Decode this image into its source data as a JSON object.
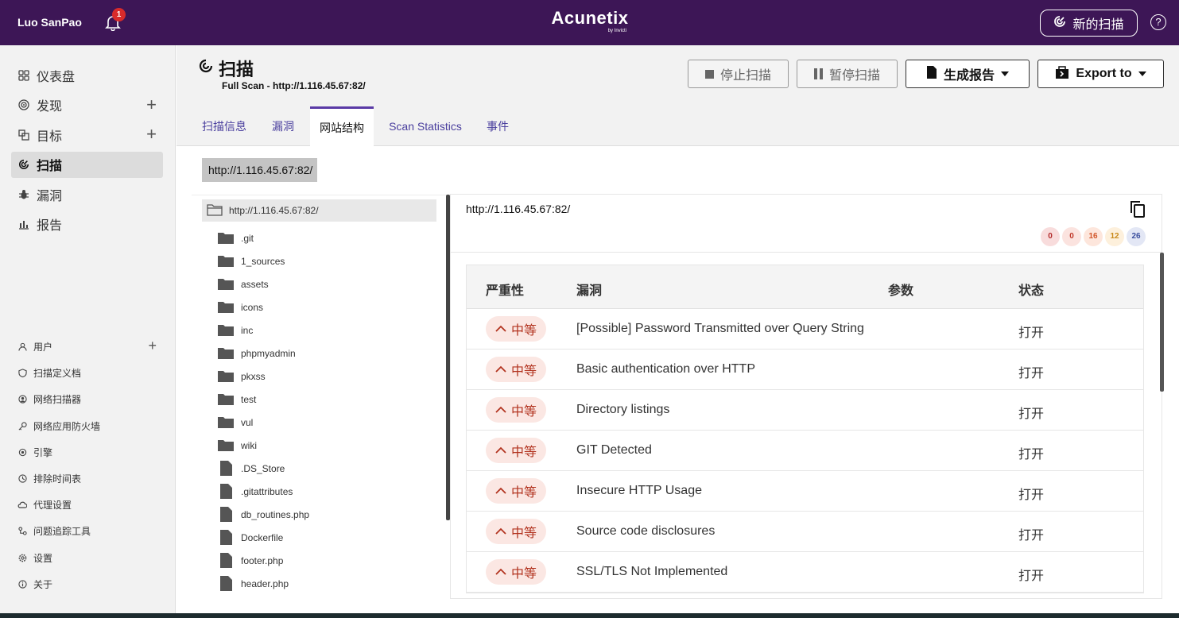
{
  "topbar": {
    "user": "Luo SanPao",
    "notification_count": "1",
    "brand": "Acunetix",
    "brand_sub": "by Invicti",
    "new_scan_label": "新的扫描",
    "help_label": "?"
  },
  "sidebar": {
    "main": [
      {
        "label": "仪表盘",
        "icon": "dashboard-icon"
      },
      {
        "label": "发现",
        "icon": "discovery-icon"
      },
      {
        "label": "目标",
        "icon": "targets-icon"
      },
      {
        "label": "扫描",
        "icon": "scan-icon"
      },
      {
        "label": "漏洞",
        "icon": "bug-icon"
      },
      {
        "label": "报告",
        "icon": "report-icon"
      }
    ],
    "sub": [
      {
        "label": "用户",
        "icon": "user-icon"
      },
      {
        "label": "扫描定义档",
        "icon": "shield-icon"
      },
      {
        "label": "网络扫描器",
        "icon": "network-icon"
      },
      {
        "label": "网络应用防火墙",
        "icon": "key-icon"
      },
      {
        "label": "引擎",
        "icon": "engine-icon"
      },
      {
        "label": "排除时间表",
        "icon": "clock-icon"
      },
      {
        "label": "代理设置",
        "icon": "cloud-icon"
      },
      {
        "label": "问题追踪工具",
        "icon": "tracker-icon"
      },
      {
        "label": "设置",
        "icon": "gear-icon"
      },
      {
        "label": "关于",
        "icon": "info-icon"
      }
    ]
  },
  "header": {
    "title": "扫描",
    "subtitle": "Full Scan - http://1.116.45.67:82/",
    "stop_label": "停止扫描",
    "pause_label": "暂停扫描",
    "report_label": "生成报告",
    "export_label": "Export to"
  },
  "tabs": [
    "扫描信息",
    "漏洞",
    "网站结构",
    "Scan Statistics",
    "事件"
  ],
  "active_tab": "网站结构",
  "breadcrumb": "http://1.116.45.67:82/",
  "tree": {
    "root": "http://1.116.45.67:82/",
    "folders": [
      ".git",
      "1_sources",
      "assets",
      "icons",
      "inc",
      "phpmyadmin",
      "pkxss",
      "test",
      "vul",
      "wiki"
    ],
    "files": [
      ".DS_Store",
      ".gitattributes",
      "db_routines.php",
      "Dockerfile",
      "footer.php",
      "header.php"
    ]
  },
  "detail": {
    "url": "http://1.116.45.67:82/",
    "counts": [
      {
        "value": "0",
        "bg": "#f8dcdc",
        "fg": "#b22a2a"
      },
      {
        "value": "0",
        "bg": "#fbe3df",
        "fg": "#c0392b"
      },
      {
        "value": "16",
        "bg": "#fde6dc",
        "fg": "#d2562a"
      },
      {
        "value": "12",
        "bg": "#fdf0dc",
        "fg": "#c98a1b"
      },
      {
        "value": "26",
        "bg": "#e3e7f5",
        "fg": "#3b4f9e"
      }
    ],
    "columns": {
      "severity": "严重性",
      "vulnerability": "漏洞",
      "parameter": "参数",
      "status": "状态"
    },
    "rows": [
      {
        "severity": "中等",
        "name": "[Possible] Password Transmitted over Query String",
        "status": "打开"
      },
      {
        "severity": "中等",
        "name": "Basic authentication over HTTP",
        "status": "打开"
      },
      {
        "severity": "中等",
        "name": "Directory listings",
        "status": "打开"
      },
      {
        "severity": "中等",
        "name": "GIT Detected",
        "status": "打开"
      },
      {
        "severity": "中等",
        "name": "Insecure HTTP Usage",
        "status": "打开"
      },
      {
        "severity": "中等",
        "name": "Source code disclosures",
        "status": "打开"
      },
      {
        "severity": "中等",
        "name": "SSL/TLS Not Implemented",
        "status": "打开"
      }
    ]
  },
  "colors": {
    "topbar": "#3d1656",
    "accent": "#5a3aa6",
    "medium_badge_bg": "#fbe7e3",
    "medium_badge_fg": "#b2331f"
  }
}
